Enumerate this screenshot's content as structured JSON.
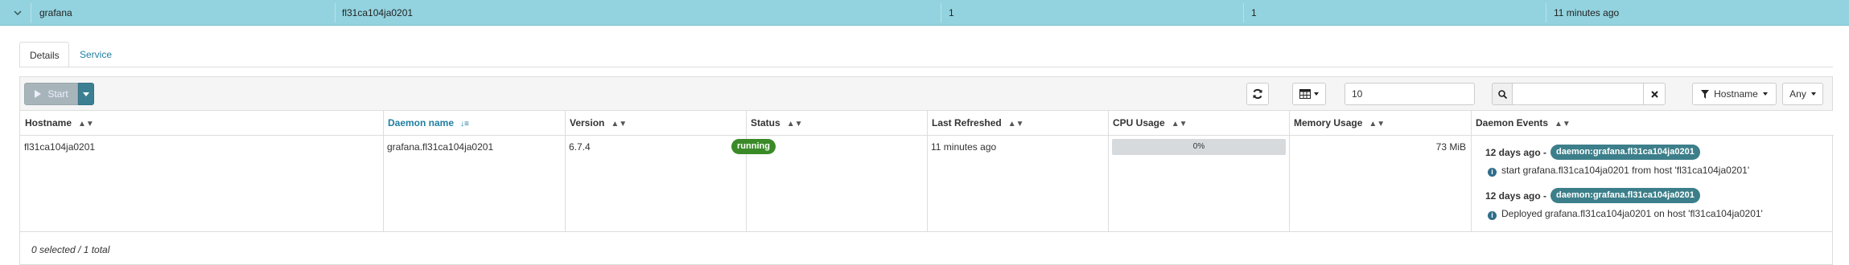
{
  "service_row": {
    "name": "grafana",
    "host": "fl31ca104ja0201",
    "running": "1",
    "size": "1",
    "refreshed": "11 minutes ago"
  },
  "tabs": [
    {
      "label": "Details",
      "active": true
    },
    {
      "label": "Service Events",
      "active": false
    }
  ],
  "toolbar": {
    "start_label": "Start",
    "page_size": "10",
    "search_value": "",
    "filter_by_label": "Hostname",
    "filter_value_label": "Any"
  },
  "columns": [
    {
      "label": "Hostname",
      "sorted": false
    },
    {
      "label": "Daemon name",
      "sorted": true
    },
    {
      "label": "Version",
      "sorted": false
    },
    {
      "label": "Status",
      "sorted": false
    },
    {
      "label": "Last Refreshed",
      "sorted": false
    },
    {
      "label": "CPU Usage",
      "sorted": false
    },
    {
      "label": "Memory Usage",
      "sorted": false
    },
    {
      "label": "Daemon Events",
      "sorted": false
    }
  ],
  "row": {
    "hostname": "fl31ca104ja0201",
    "daemon_name": "grafana.fl31ca104ja0201",
    "version": "6.7.4",
    "status": "running",
    "last_refreshed": "11 minutes ago",
    "cpu_usage": "0%",
    "cpu_usage_fraction": 0,
    "memory_usage": "73 MiB",
    "events": [
      {
        "time": "12 days ago -",
        "daemon": "daemon:grafana.fl31ca104ja0201",
        "message": "start grafana.fl31ca104ja0201 from host 'fl31ca104ja0201'"
      },
      {
        "time": "12 days ago -",
        "daemon": "daemon:grafana.fl31ca104ja0201",
        "message": "Deployed grafana.fl31ca104ja0201 on host 'fl31ca104ja0201'"
      }
    ]
  },
  "footer": {
    "selection": "0 selected / 1 total"
  },
  "colors": {
    "row_highlight": "#93d3df",
    "accent": "#1f7fa1",
    "running_badge": "#3a8a27",
    "event_badge": "#3c7f8a"
  }
}
